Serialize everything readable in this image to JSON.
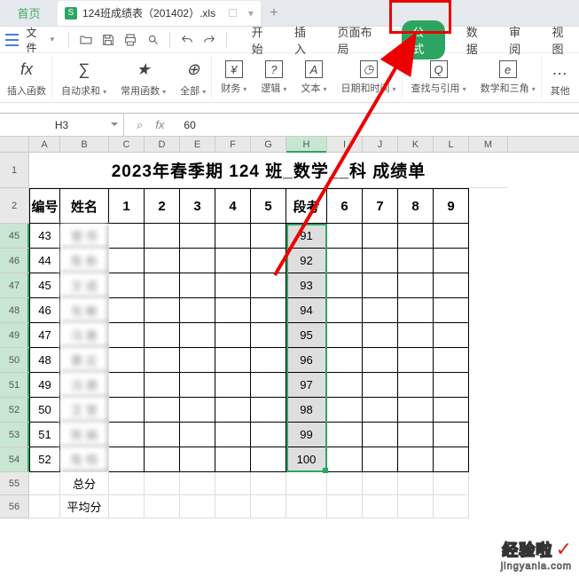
{
  "tabbar": {
    "home": "首页",
    "filename": "124班成绩表（201402）.xls",
    "add": "+"
  },
  "menubar": {
    "file_label": "文件",
    "qat": {
      "open": "open",
      "save": "save",
      "print": "print",
      "preview": "preview",
      "undo": "undo",
      "redo": "redo"
    },
    "tabs": {
      "start": "开始",
      "insert": "插入",
      "layout": "页面布局",
      "formula": "公式",
      "data": "数据",
      "review": "审阅",
      "view": "视图"
    }
  },
  "ribbon": {
    "fx": {
      "icon": "fx",
      "label": "插入函数"
    },
    "sum": {
      "icon": "∑",
      "label": "自动求和"
    },
    "common": {
      "icon": "★",
      "label": "常用函数"
    },
    "all": {
      "icon": "⊕",
      "label": "全部"
    },
    "finance": {
      "icon": "¥",
      "label": "财务"
    },
    "logic": {
      "icon": "?",
      "label": "逻辑"
    },
    "text": {
      "icon": "A",
      "label": "文本"
    },
    "datetime": {
      "icon": "◷",
      "label": "日期和时间"
    },
    "lookup": {
      "icon": "Q",
      "label": "查找与引用"
    },
    "math": {
      "icon": "e",
      "label": "数学和三角"
    },
    "other": {
      "icon": "…",
      "label": "其他"
    }
  },
  "fxbar": {
    "cellref": "H3",
    "search_icon": "⌕",
    "fx": "fx",
    "value": "60"
  },
  "columns": [
    "A",
    "B",
    "C",
    "D",
    "E",
    "F",
    "G",
    "H",
    "I",
    "J",
    "K",
    "L",
    "M"
  ],
  "title": "2023年春季期 124 班_数学__科 成绩单",
  "row2": {
    "num": "2",
    "col1": "编号",
    "col2": "姓名",
    "c3": "1",
    "c4": "2",
    "c5": "3",
    "c6": "4",
    "c7": "5",
    "c8": "段考",
    "c9": "6",
    "c10": "7",
    "c11": "8",
    "c12": "9"
  },
  "rows": [
    {
      "rn": "45",
      "id": "43",
      "name": "管   伟",
      "score": "91"
    },
    {
      "rn": "46",
      "id": "44",
      "name": "陈   彬",
      "score": "92"
    },
    {
      "rn": "47",
      "id": "45",
      "name": "文   成",
      "score": "93"
    },
    {
      "rn": "48",
      "id": "46",
      "name": "包   敏",
      "score": "94"
    },
    {
      "rn": "49",
      "id": "47",
      "name": "冯   惠",
      "score": "95"
    },
    {
      "rn": "50",
      "id": "48",
      "name": "蔡   庄",
      "score": "96"
    },
    {
      "rn": "51",
      "id": "49",
      "name": "冯   德",
      "score": "97"
    },
    {
      "rn": "52",
      "id": "50",
      "name": "艾   慧",
      "score": "98"
    },
    {
      "rn": "53",
      "id": "51",
      "name": "陈   娟",
      "score": "99"
    },
    {
      "rn": "54",
      "id": "52",
      "name": "陈   明",
      "score": "100"
    }
  ],
  "row55": {
    "rn": "55",
    "label": "总分"
  },
  "row56": {
    "rn": "56",
    "label": "平均分"
  },
  "watermark": {
    "top": "经验啦",
    "sub": "jingyanla.com"
  },
  "chart_data": {
    "type": "table",
    "title": "2023年春季期 124 班_数学__科 成绩单",
    "columns": [
      "编号",
      "姓名",
      "1",
      "2",
      "3",
      "4",
      "5",
      "段考",
      "6",
      "7",
      "8",
      "9"
    ],
    "rows": [
      [
        "43",
        "管 伟",
        "",
        "",
        "",
        "",
        "",
        "91",
        "",
        "",
        "",
        ""
      ],
      [
        "44",
        "陈 彬",
        "",
        "",
        "",
        "",
        "",
        "92",
        "",
        "",
        "",
        ""
      ],
      [
        "45",
        "文 成",
        "",
        "",
        "",
        "",
        "",
        "93",
        "",
        "",
        "",
        ""
      ],
      [
        "46",
        "包 敏",
        "",
        "",
        "",
        "",
        "",
        "94",
        "",
        "",
        "",
        ""
      ],
      [
        "47",
        "冯 惠",
        "",
        "",
        "",
        "",
        "",
        "95",
        "",
        "",
        "",
        ""
      ],
      [
        "48",
        "蔡 庄",
        "",
        "",
        "",
        "",
        "",
        "96",
        "",
        "",
        "",
        ""
      ],
      [
        "49",
        "冯 德",
        "",
        "",
        "",
        "",
        "",
        "97",
        "",
        "",
        "",
        ""
      ],
      [
        "50",
        "艾 慧",
        "",
        "",
        "",
        "",
        "",
        "98",
        "",
        "",
        "",
        ""
      ],
      [
        "51",
        "陈 娟",
        "",
        "",
        "",
        "",
        "",
        "99",
        "",
        "",
        "",
        ""
      ],
      [
        "52",
        "陈 明",
        "",
        "",
        "",
        "",
        "",
        "100",
        "",
        "",
        "",
        ""
      ]
    ]
  }
}
